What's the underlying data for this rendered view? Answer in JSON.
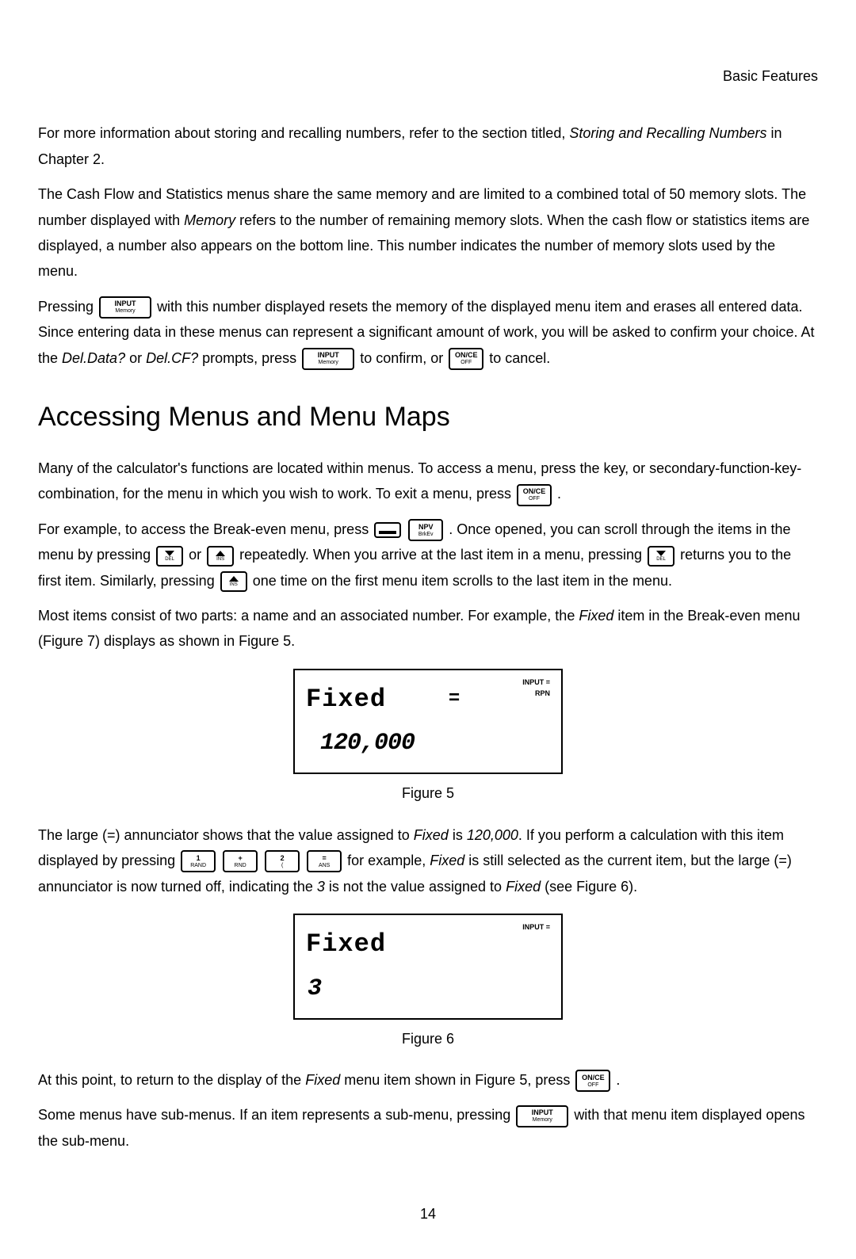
{
  "header": {
    "section_title": "Basic Features"
  },
  "para1": {
    "t1": "For more information about storing and recalling numbers, refer to the section titled, ",
    "i1": "Storing and Recalling Numbers",
    "t2": " in Chapter 2."
  },
  "para2": {
    "t1": "The Cash Flow and Statistics menus share the same memory and are limited to a combined total of 50 memory slots. The number displayed with ",
    "i1": "Memory",
    "t2": " refers to the number of remaining memory slots. When the cash flow or statistics items are displayed, a number also appears on the bottom line. This number indicates the number of memory slots used by the menu."
  },
  "para3": {
    "a": "Pressing ",
    "b": " with this number displayed resets the memory of the displayed menu item and erases all entered data. Since entering data in these menus can represent a significant amount of work, you will be asked to confirm your choice. At the ",
    "i1": "Del.Data?",
    "c": " or ",
    "i2": "Del.CF?",
    "d": " prompts, press ",
    "e": " to confirm, or ",
    "f": " to cancel."
  },
  "h2": "Accessing Menus and Menu Maps",
  "para4": {
    "a": "Many of the calculator's functions are located within menus. To access a menu, press the key, or secondary-function-key-combination, for the menu in which you wish to work. To exit a menu, press ",
    "b": "."
  },
  "para5": {
    "a": "For example, to access the Break-even menu, press ",
    "b": ". Once opened, you can scroll through the items in the menu by pressing ",
    "c": "or",
    "d": " repeatedly. When you arrive at the last item in a menu, pressing ",
    "e": " returns you to the first item. Similarly, pressing ",
    "f": " one time on the first menu item scrolls to the last item in the menu."
  },
  "para6": {
    "a": "Most items consist of two parts: a name and an associated number. For example, the ",
    "i1": "Fixed",
    "b": " item in the Break-even menu (Figure 7) displays as shown in Figure 5."
  },
  "lcd1": {
    "name": "Fixed",
    "eq": "=",
    "ann1": "INPUT  =",
    "ann2": "RPN",
    "value": "120,000"
  },
  "fig5": "Figure 5",
  "para7": {
    "a": "The large (=) annunciator shows that the value assigned to ",
    "i1": "Fixed",
    "b": " is ",
    "i2": "120,000",
    "c": ". If you perform a calculation with this item displayed by pressing ",
    "d": " for example, ",
    "i3": "Fixed",
    "e": " is still selected as the current item, but the large (=) annunciator is now turned off, indicating the ",
    "i4": "3",
    "f": " is not the value assigned to ",
    "i5": "Fixed",
    "g": " (see Figure 6)."
  },
  "lcd2": {
    "name": "Fixed",
    "ann1": "INPUT  =",
    "value": "3"
  },
  "fig6": "Figure 6",
  "para8": {
    "a": "At this point, to return to the display of the ",
    "i1": "Fixed",
    "b": " menu item shown in Figure 5, press ",
    "c": "."
  },
  "para9": {
    "a": "Some menus have sub-menus. If an item represents a sub-menu, pressing ",
    "b": " with that menu item displayed opens the sub-menu."
  },
  "keys": {
    "input_top": "INPUT",
    "input_bot": "Memory",
    "once_top": "ON/CE",
    "once_bot": "OFF",
    "npv_top": "NPV",
    "npv_bot": "BrkEv",
    "down_sub": "DEL",
    "up_sub": "INS",
    "k1_top": "1",
    "k1_bot": "RAND",
    "kplus_top": "+",
    "kplus_bot": "RND",
    "k2_top": "2",
    "k2_bot": "(",
    "keq_top": "=",
    "keq_bot": "ANS"
  },
  "page": "14"
}
